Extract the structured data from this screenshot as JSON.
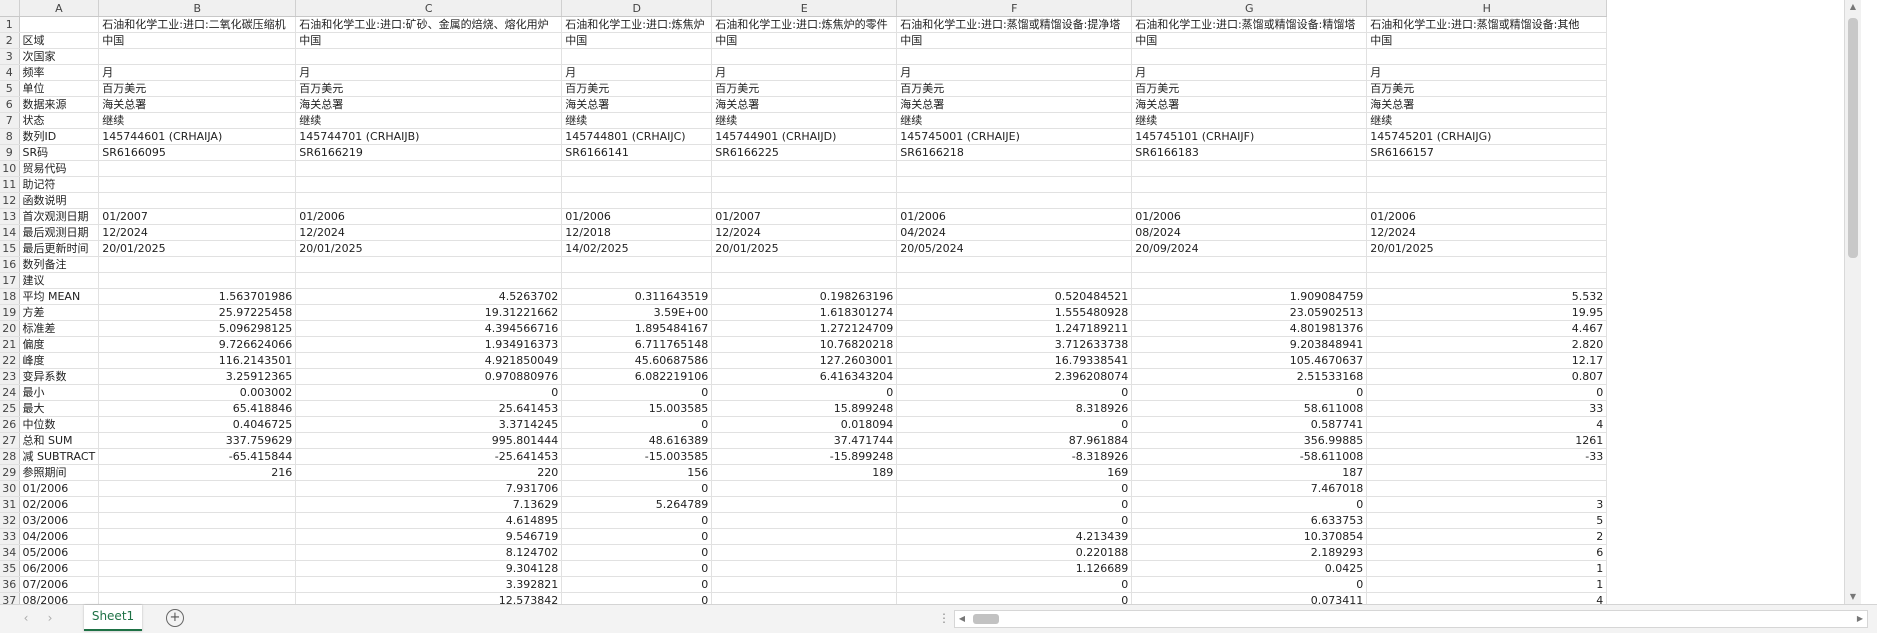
{
  "columns": [
    "A",
    "B",
    "C",
    "D",
    "E",
    "F",
    "G",
    "H"
  ],
  "rows": [
    [
      "1",
      "",
      "石油和化学工业:进口:二氧化碳压缩机",
      "石油和化学工业:进口:矿砂、金属的焙烧、熔化用炉",
      "石油和化学工业:进口:炼焦炉",
      "石油和化学工业:进口:炼焦炉的零件",
      "石油和化学工业:进口:蒸馏或精馏设备:提净塔",
      "石油和化学工业:进口:蒸馏或精馏设备:精馏塔",
      "石油和化学工业:进口:蒸馏或精馏设备:其他"
    ],
    [
      "2",
      "区域",
      "中国",
      "中国",
      "中国",
      "中国",
      "中国",
      "中国",
      "中国"
    ],
    [
      "3",
      "次国家",
      "",
      "",
      "",
      "",
      "",
      "",
      ""
    ],
    [
      "4",
      "频率",
      "月",
      "月",
      "月",
      "月",
      "月",
      "月",
      "月"
    ],
    [
      "5",
      "单位",
      "百万美元",
      "百万美元",
      "百万美元",
      "百万美元",
      "百万美元",
      "百万美元",
      "百万美元"
    ],
    [
      "6",
      "数据来源",
      "海关总署",
      "海关总署",
      "海关总署",
      "海关总署",
      "海关总署",
      "海关总署",
      "海关总署"
    ],
    [
      "7",
      "状态",
      "继续",
      "继续",
      "继续",
      "继续",
      "继续",
      "继续",
      "继续"
    ],
    [
      "8",
      "数列ID",
      "145744601 (CRHAIJA)",
      "145744701 (CRHAIJB)",
      "145744801 (CRHAIJC)",
      "145744901 (CRHAIJD)",
      "145745001 (CRHAIJE)",
      "145745101 (CRHAIJF)",
      "145745201 (CRHAIJG)"
    ],
    [
      "9",
      "SR码",
      "SR6166095",
      "SR6166219",
      "SR6166141",
      "SR6166225",
      "SR6166218",
      "SR6166183",
      "SR6166157"
    ],
    [
      "10",
      "贸易代码",
      "",
      "",
      "",
      "",
      "",
      "",
      ""
    ],
    [
      "11",
      "助记符",
      "",
      "",
      "",
      "",
      "",
      "",
      ""
    ],
    [
      "12",
      "函数说明",
      "",
      "",
      "",
      "",
      "",
      "",
      ""
    ],
    [
      "13",
      "首次观测日期",
      "01/2007",
      "01/2006",
      "01/2006",
      "01/2007",
      "01/2006",
      "01/2006",
      "01/2006"
    ],
    [
      "14",
      "最后观测日期",
      "12/2024",
      "12/2024",
      "12/2018",
      "12/2024",
      "04/2024",
      "08/2024",
      "12/2024"
    ],
    [
      "15",
      "最后更新时间",
      "20/01/2025",
      "20/01/2025",
      "14/02/2025",
      "20/01/2025",
      "20/05/2024",
      "20/09/2024",
      "20/01/2025"
    ],
    [
      "16",
      "数列备注",
      "",
      "",
      "",
      "",
      "",
      "",
      ""
    ],
    [
      "17",
      "建议",
      "",
      "",
      "",
      "",
      "",
      "",
      ""
    ],
    [
      "18",
      "平均 MEAN",
      "1.563701986",
      "4.5263702",
      "0.311643519",
      "0.198263196",
      "0.520484521",
      "1.909084759",
      "5.532"
    ],
    [
      "19",
      "方差",
      "25.97225458",
      "19.31221662",
      "3.59E+00",
      "1.618301274",
      "1.555480928",
      "23.05902513",
      "19.95"
    ],
    [
      "20",
      "标准差",
      "5.096298125",
      "4.394566716",
      "1.895484167",
      "1.272124709",
      "1.247189211",
      "4.801981376",
      "4.467"
    ],
    [
      "21",
      "偏度",
      "9.726624066",
      "1.934916373",
      "6.711765148",
      "10.76820218",
      "3.712633738",
      "9.203848941",
      "2.820"
    ],
    [
      "22",
      "峰度",
      "116.2143501",
      "4.921850049",
      "45.60687586",
      "127.2603001",
      "16.79338541",
      "105.4670637",
      "12.17"
    ],
    [
      "23",
      "变异系数",
      "3.25912365",
      "0.970880976",
      "6.082219106",
      "6.416343204",
      "2.396208074",
      "2.51533168",
      "0.807"
    ],
    [
      "24",
      "最小",
      "0.003002",
      "0",
      "0",
      "0",
      "0",
      "0",
      "0"
    ],
    [
      "25",
      "最大",
      "65.418846",
      "25.641453",
      "15.003585",
      "15.899248",
      "8.318926",
      "58.611008",
      "33"
    ],
    [
      "26",
      "中位数",
      "0.4046725",
      "3.3714245",
      "0",
      "0.018094",
      "0",
      "0.587741",
      "4"
    ],
    [
      "27",
      "总和 SUM",
      "337.759629",
      "995.801444",
      "48.616389",
      "37.471744",
      "87.961884",
      "356.99885",
      "1261"
    ],
    [
      "28",
      "减 SUBTRACT",
      "-65.415844",
      "-25.641453",
      "-15.003585",
      "-15.899248",
      "-8.318926",
      "-58.611008",
      "-33"
    ],
    [
      "29",
      "参照期间",
      "216",
      "220",
      "156",
      "189",
      "169",
      "187",
      ""
    ],
    [
      "30",
      "01/2006",
      "",
      "7.931706",
      "0",
      "",
      "0",
      "7.467018",
      ""
    ],
    [
      "31",
      "02/2006",
      "",
      "7.13629",
      "5.264789",
      "",
      "0",
      "0",
      "3"
    ],
    [
      "32",
      "03/2006",
      "",
      "4.614895",
      "0",
      "",
      "0",
      "6.633753",
      "5"
    ],
    [
      "33",
      "04/2006",
      "",
      "9.546719",
      "0",
      "",
      "4.213439",
      "10.370854",
      "2"
    ],
    [
      "34",
      "05/2006",
      "",
      "8.124702",
      "0",
      "",
      "0.220188",
      "2.189293",
      "6"
    ],
    [
      "35",
      "06/2006",
      "",
      "9.304128",
      "0",
      "",
      "1.126689",
      "0.0425",
      "1"
    ],
    [
      "36",
      "07/2006",
      "",
      "3.392821",
      "0",
      "",
      "0",
      "0",
      "1"
    ],
    [
      "37",
      "08/2006",
      "",
      "12.573842",
      "0",
      "",
      "0",
      "0.073411",
      "4"
    ]
  ],
  "sheet_tab": "Sheet1",
  "add_sheet_glyph": "+",
  "more_glyph": "⋮"
}
